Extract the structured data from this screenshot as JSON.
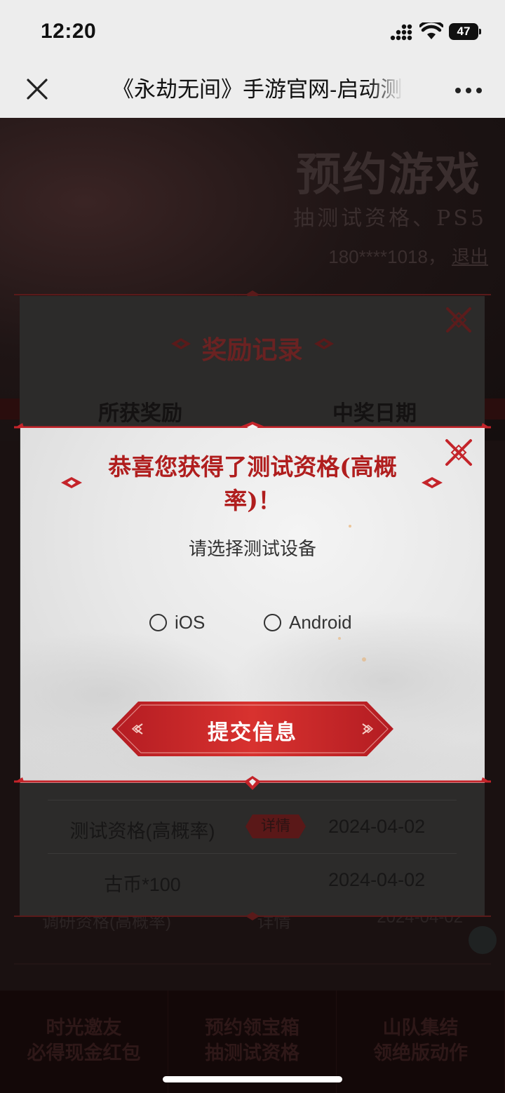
{
  "status_bar": {
    "time": "12:20",
    "battery": "47"
  },
  "nav": {
    "title": "《永劫无间》手游官网-启动测试"
  },
  "background_page": {
    "title": "预约游戏",
    "subtitle": "抽测试资格、PS5",
    "user_phone": "180****1018",
    "logout_label": "退出",
    "hidden_row": [
      "调研资格(高概率)",
      "详情",
      "2024-04-02"
    ],
    "bottom_tabs": [
      {
        "line1": "时光邀友",
        "line2": "必得现金红包"
      },
      {
        "line1": "预约领宝箱",
        "line2": "抽测试资格"
      },
      {
        "line1": "山队集结",
        "line2": "领绝版动作"
      }
    ]
  },
  "records_panel": {
    "title": "奖励记录",
    "columns": [
      "所获奖励",
      "中奖日期"
    ],
    "rows": [
      {
        "reward": "测试资格(高概率)",
        "detail_label": "详情",
        "date": "2024-04-02"
      },
      {
        "reward": "古币*100",
        "detail_label": "",
        "date": "2024-04-02"
      }
    ]
  },
  "modal": {
    "title": "恭喜您获得了测试资格(高概率)！",
    "prompt": "请选择测试设备",
    "options": [
      {
        "label": "iOS",
        "selected": false
      },
      {
        "label": "Android",
        "selected": false
      }
    ],
    "submit_label": "提交信息"
  },
  "colors": {
    "accent_red": "#c4242a",
    "title_red": "#b01e1e",
    "modal_bg": "#ebebeb",
    "status_bg": "#ededed"
  }
}
